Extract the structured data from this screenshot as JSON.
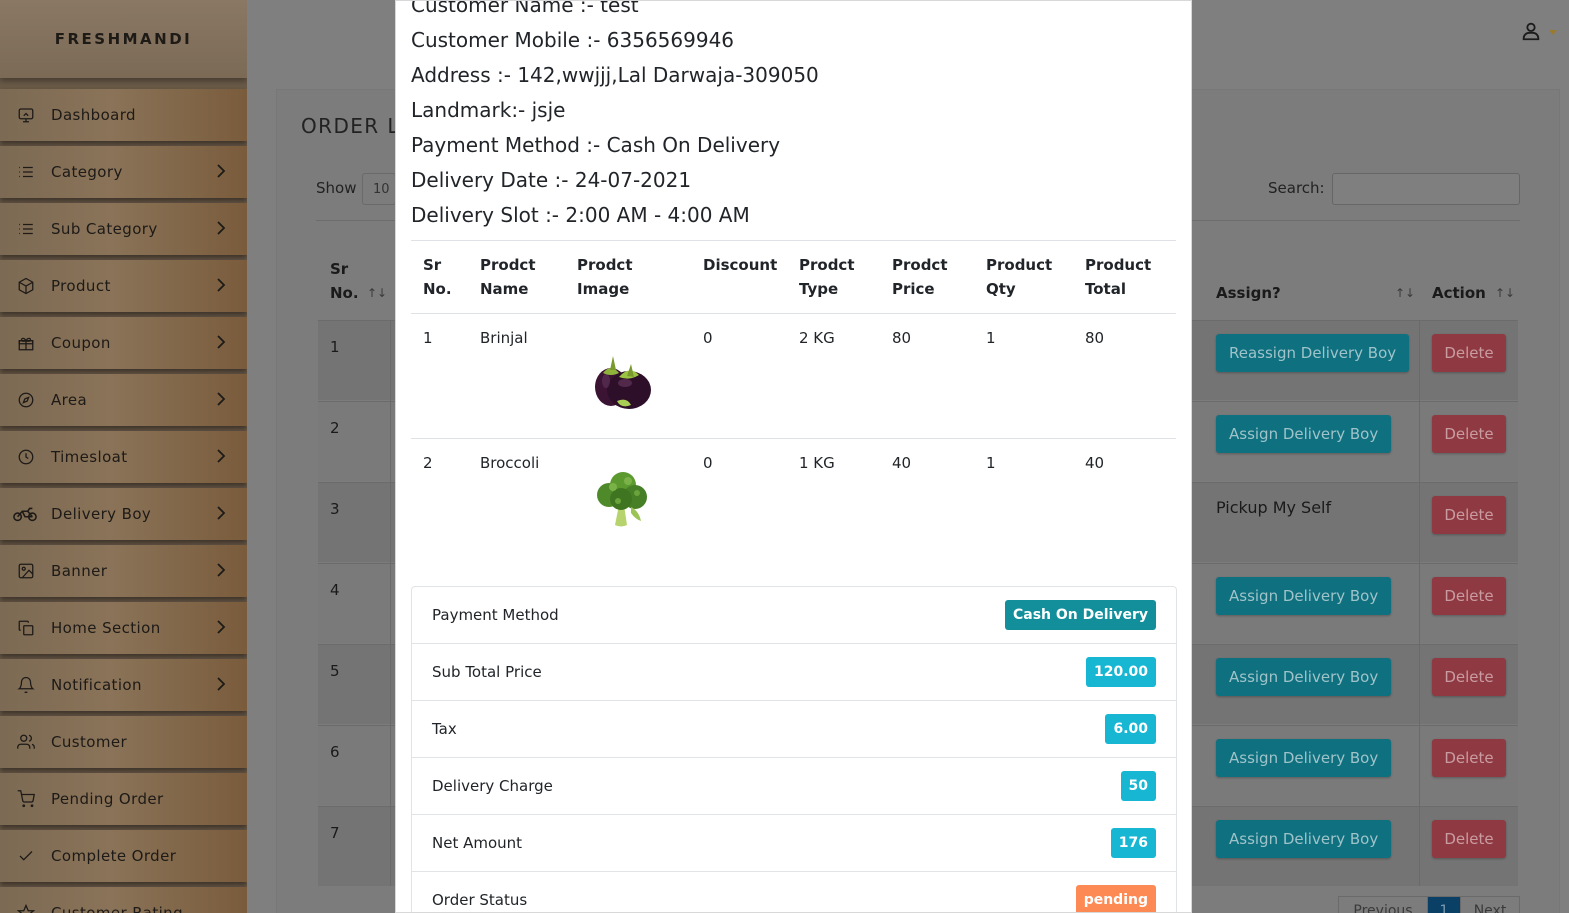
{
  "brand": "FRESHMANDI",
  "sidebar": {
    "items": [
      {
        "label": "Dashboard",
        "icon": "monitor-icon",
        "has_chevron": false
      },
      {
        "label": "Category",
        "icon": "list-icon",
        "has_chevron": true
      },
      {
        "label": "Sub Category",
        "icon": "list-icon",
        "has_chevron": true
      },
      {
        "label": "Product",
        "icon": "box-icon",
        "has_chevron": true
      },
      {
        "label": "Coupon",
        "icon": "gift-icon",
        "has_chevron": true
      },
      {
        "label": "Area",
        "icon": "compass-icon",
        "has_chevron": true
      },
      {
        "label": "Timesloat",
        "icon": "clock-icon",
        "has_chevron": true
      },
      {
        "label": "Delivery Boy",
        "icon": "motorcycle-icon",
        "has_chevron": true
      },
      {
        "label": "Banner",
        "icon": "image-icon",
        "has_chevron": true
      },
      {
        "label": "Home Section",
        "icon": "copy-icon",
        "has_chevron": true
      },
      {
        "label": "Notification",
        "icon": "bell-icon",
        "has_chevron": true
      },
      {
        "label": "Customer",
        "icon": "users-icon",
        "has_chevron": false
      },
      {
        "label": "Pending Order",
        "icon": "cart-icon",
        "has_chevron": false
      },
      {
        "label": "Complete Order",
        "icon": "check-icon",
        "has_chevron": false
      },
      {
        "label": "Customer Rating",
        "icon": "star-icon",
        "has_chevron": false
      }
    ]
  },
  "main": {
    "title": "ORDER L",
    "show_label": "Show",
    "show_value": "10",
    "search_label": "Search:",
    "columns": {
      "sr": "Sr",
      "no": "No.",
      "assign": "Assign?",
      "action": "Action"
    },
    "sort_glyph": "↑↓",
    "rows": [
      {
        "no": "1",
        "assign": "Reassign Delivery Boy",
        "type": "button"
      },
      {
        "no": "2",
        "assign": "Assign Delivery Boy",
        "type": "button"
      },
      {
        "no": "3",
        "assign": "Pickup My Self",
        "type": "text"
      },
      {
        "no": "4",
        "assign": "Assign Delivery Boy",
        "type": "button"
      },
      {
        "no": "5",
        "assign": "Assign Delivery Boy",
        "type": "button"
      },
      {
        "no": "6",
        "assign": "Assign Delivery Boy",
        "type": "button"
      },
      {
        "no": "7",
        "assign": "Assign Delivery Boy",
        "type": "button"
      }
    ],
    "delete_label": "Delete",
    "pagination": {
      "previous": "Previous",
      "current": "1",
      "next": "Next"
    }
  },
  "modal": {
    "info": [
      "Customer Name :- test",
      "Customer Mobile :- 6356569946",
      "Address :- 142,wwjjj,Lal Darwaja-309050",
      "Landmark:- jsje",
      "Payment Method :- Cash On Delivery",
      "Delivery Date :- 24-07-2021",
      "Delivery Slot :- 2:00 AM - 4:00 AM"
    ],
    "product_table": {
      "headers": [
        [
          "Sr",
          "No."
        ],
        [
          "Prodct",
          "Name"
        ],
        [
          "Prodct",
          "Image"
        ],
        [
          "Discount",
          ""
        ],
        [
          "Prodct",
          "Type"
        ],
        [
          "Prodct",
          "Price"
        ],
        [
          "Product",
          "Qty"
        ],
        [
          "Product",
          "Total"
        ]
      ],
      "rows": [
        {
          "sr": "1",
          "name": "Brinjal",
          "image": "brinjal-image",
          "discount": "0",
          "type": "2 KG",
          "price": "80",
          "qty": "1",
          "total": "80"
        },
        {
          "sr": "2",
          "name": "Broccoli",
          "image": "broccoli-image",
          "discount": "0",
          "type": "1 KG",
          "price": "40",
          "qty": "1",
          "total": "40"
        }
      ]
    },
    "summary": [
      {
        "label": "Payment Method",
        "value": "Cash On Delivery",
        "color": "#17a2b8"
      },
      {
        "label": "Sub Total Price",
        "value": "120.00",
        "color": "#17a2b8"
      },
      {
        "label": "Tax",
        "value": "6.00",
        "color": "#17a2b8"
      },
      {
        "label": "Delivery Charge",
        "value": "50",
        "color": "#17a2b8"
      },
      {
        "label": "Net Amount",
        "value": "176",
        "color": "#17a2b8"
      },
      {
        "label": "Order Status",
        "value": "pending",
        "color": "#fd7e4c"
      }
    ]
  },
  "colors": {
    "accent": "#17a2b8",
    "payment_badge": "#138f9c",
    "danger": "#dc3545",
    "status_pending": "#fd8a54"
  }
}
